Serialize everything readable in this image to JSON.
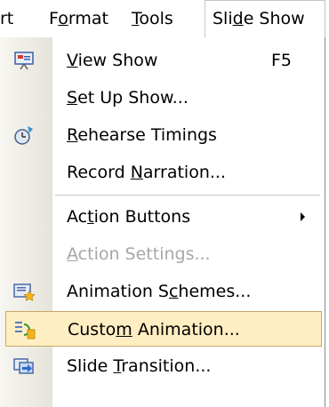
{
  "menubar": {
    "items": [
      {
        "pre": "rt",
        "acc": "",
        "post": ""
      },
      {
        "pre": "F",
        "acc": "o",
        "post": "rmat"
      },
      {
        "pre": "",
        "acc": "T",
        "post": "ools"
      },
      {
        "pre": "Sli",
        "acc": "d",
        "post": "e Show"
      }
    ]
  },
  "menu": {
    "items": [
      {
        "pre": "",
        "acc": "V",
        "post": "iew Show",
        "shortcut": "F5",
        "icon": "view-show-icon"
      },
      {
        "pre": "",
        "acc": "S",
        "post": "et Up Show...",
        "icon": ""
      },
      {
        "pre": "",
        "acc": "R",
        "post": "ehearse Timings",
        "icon": "rehearse-timings-icon"
      },
      {
        "pre": "Record ",
        "acc": "N",
        "post": "arration...",
        "icon": ""
      },
      {
        "pre": "Ac",
        "acc": "t",
        "post": "ion Buttons",
        "icon": "",
        "submenu": "true"
      },
      {
        "pre": "",
        "acc": "A",
        "post": "ction Settings...",
        "icon": "",
        "disabled": "true"
      },
      {
        "pre": "Animation S",
        "acc": "c",
        "post": "hemes...",
        "icon": "animation-schemes-icon"
      },
      {
        "pre": "Custo",
        "acc": "m",
        "post": " Animation...",
        "icon": "custom-animation-icon",
        "highlighted": "true"
      },
      {
        "pre": "Slide ",
        "acc": "T",
        "post": "ransition...",
        "icon": "slide-transition-icon"
      }
    ]
  },
  "colors": {
    "highlight_bg": "#ffeec2",
    "highlight_border": "#c8a765",
    "disabled_text": "#a7a6aa"
  }
}
